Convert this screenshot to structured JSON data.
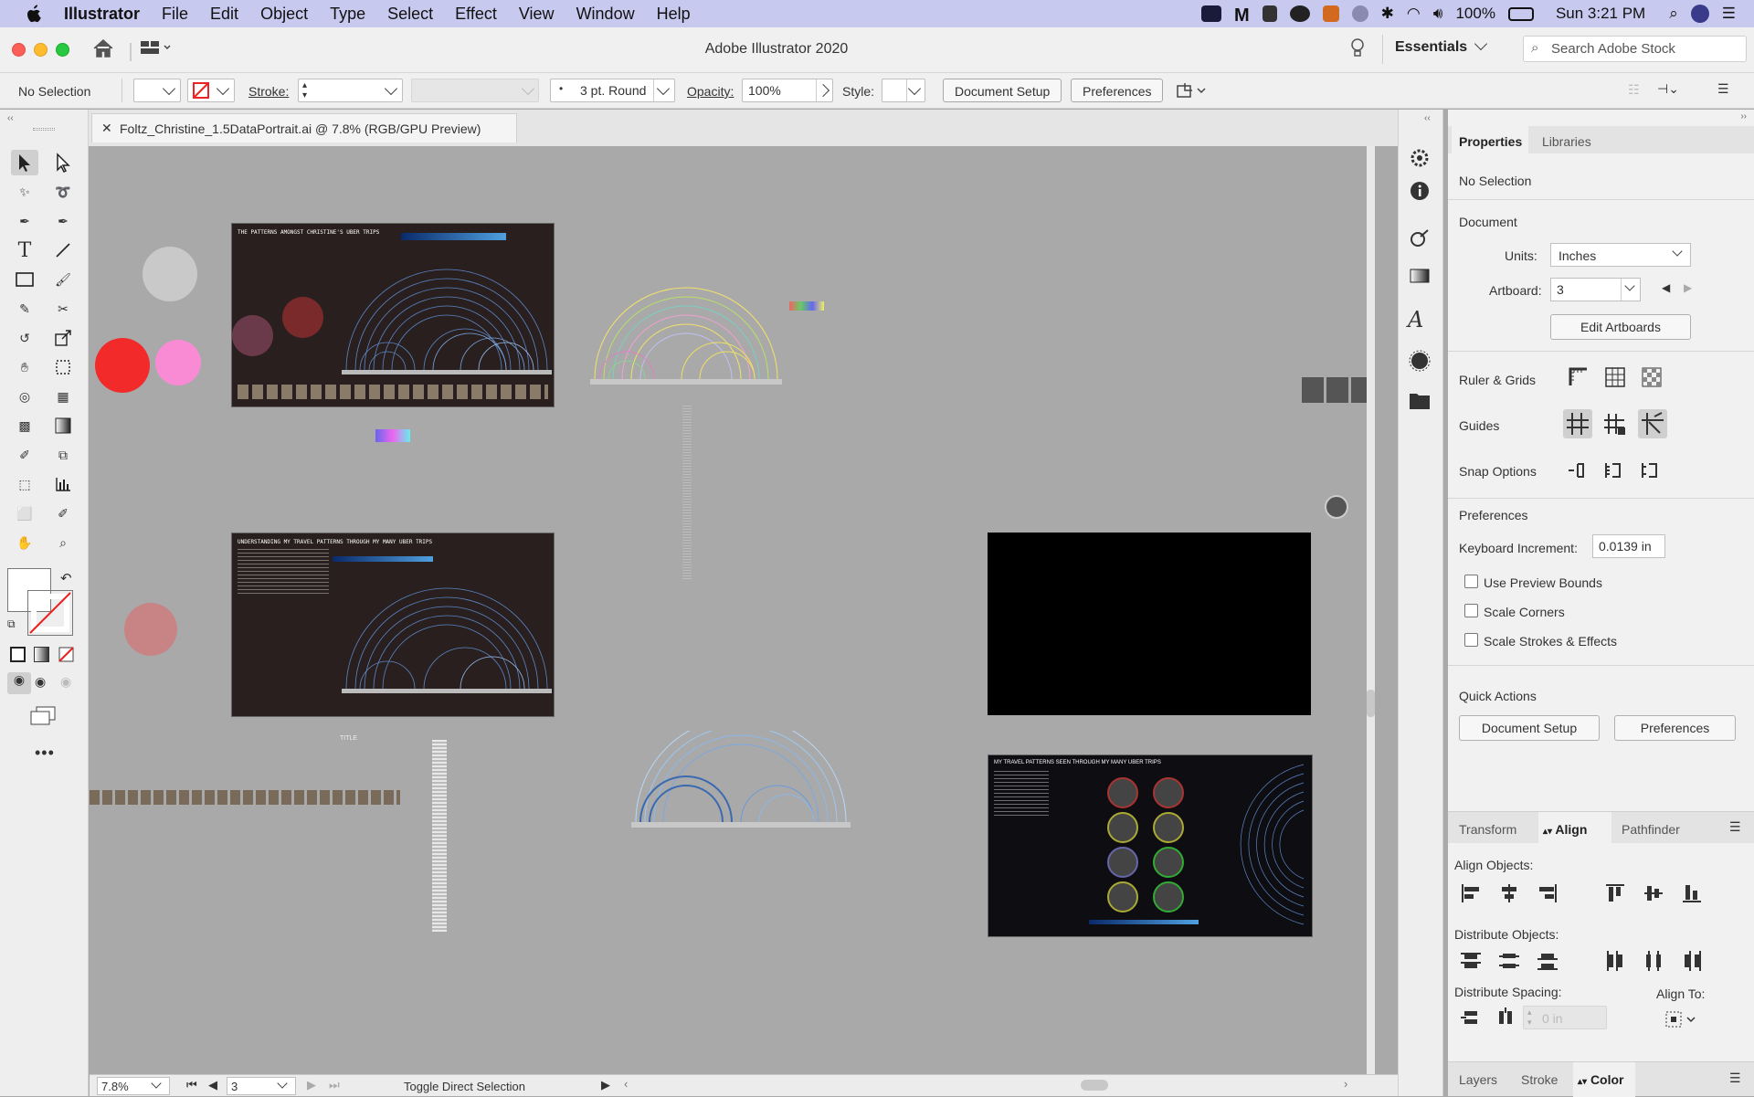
{
  "menubar": {
    "app_name": "Illustrator",
    "items": [
      "File",
      "Edit",
      "Object",
      "Type",
      "Select",
      "Effect",
      "View",
      "Window",
      "Help"
    ],
    "battery": "100%",
    "clock": "Sun 3:21 PM"
  },
  "appbar": {
    "title": "Adobe Illustrator 2020",
    "workspace": "Essentials",
    "search_placeholder": "Search Adobe Stock"
  },
  "controlbar": {
    "selection": "No Selection",
    "stroke_label": "Stroke:",
    "brush": "3 pt. Round",
    "opacity_label": "Opacity:",
    "opacity_value": "100%",
    "style_label": "Style:",
    "doc_setup": "Document Setup",
    "preferences": "Preferences"
  },
  "tab": {
    "document": "Foltz_Christine_1.5DataPortrait.ai @ 7.8% (RGB/GPU Preview)"
  },
  "canvas": {
    "art1_title": "THE PATTERNS AMONGST CHRISTINE'S UBER TRIPS",
    "art2_title": "UNDERSTANDING MY TRAVEL PATTERNS THROUGH MY MANY UBER TRIPS",
    "art3_title": "MY TRAVEL PATTERNS SEEN THROUGH MY MANY UBER TRIPS",
    "small_title": "TITLE"
  },
  "status": {
    "zoom": "7.8%",
    "artboard": "3",
    "tool_hint": "Toggle Direct Selection"
  },
  "properties": {
    "tabs": [
      "Properties",
      "Libraries"
    ],
    "no_selection": "No Selection",
    "document_heading": "Document",
    "units_label": "Units:",
    "units_value": "Inches",
    "artboard_label": "Artboard:",
    "artboard_value": "3",
    "edit_artboards": "Edit Artboards",
    "ruler_grids": "Ruler & Grids",
    "guides": "Guides",
    "snap_options": "Snap Options",
    "preferences_heading": "Preferences",
    "keyboard_increment_label": "Keyboard Increment:",
    "keyboard_increment_value": "0.0139 in",
    "use_preview_bounds": "Use Preview Bounds",
    "scale_corners": "Scale Corners",
    "scale_strokes": "Scale Strokes & Effects",
    "quick_actions": "Quick Actions",
    "doc_setup_btn": "Document Setup",
    "prefs_btn": "Preferences"
  },
  "align_panel": {
    "tabs": [
      "Transform",
      "Align",
      "Pathfinder"
    ],
    "align_objects": "Align Objects:",
    "distribute_objects": "Distribute Objects:",
    "distribute_spacing": "Distribute Spacing:",
    "align_to": "Align To:",
    "spacing_value": "0 in"
  },
  "bottom_tabs": [
    "Layers",
    "Stroke",
    "Color"
  ],
  "colors": {
    "menubar": "#c7c9ef",
    "canvas": "#a9a9a9",
    "accent_red": "#f22a2a",
    "accent_pink": "#f98bd4"
  }
}
